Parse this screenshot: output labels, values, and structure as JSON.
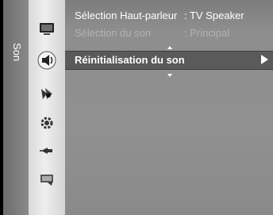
{
  "sidebar": {
    "label": "Son"
  },
  "icons": [
    {
      "name": "picture-icon",
      "selected": false
    },
    {
      "name": "sound-icon",
      "selected": true
    },
    {
      "name": "channel-icon",
      "selected": false
    },
    {
      "name": "setup-icon",
      "selected": false
    },
    {
      "name": "input-icon",
      "selected": false
    },
    {
      "name": "application-icon",
      "selected": false
    }
  ],
  "menu": {
    "items": [
      {
        "label": "Sélection Haut-parleur",
        "value": ": TV Speaker"
      },
      {
        "label": "Sélection du son",
        "value": ": Principal"
      },
      {
        "label": "Réinitialisation du son",
        "value": ""
      }
    ]
  },
  "colors": {
    "highlight": "#5a5a5a",
    "panel": "#8e8e8e",
    "icon_column": "#e6e6e6"
  }
}
